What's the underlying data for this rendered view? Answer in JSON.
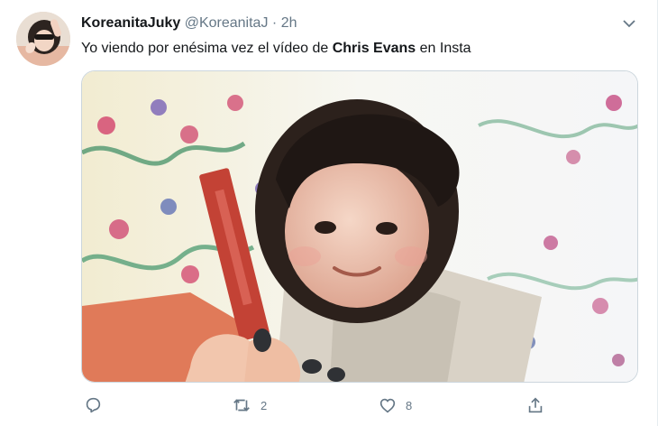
{
  "tweet": {
    "display_name": "KoreanitaJuky",
    "handle": "@KoreanitaJ",
    "separator": "·",
    "timestamp": "2h",
    "text_before": "Yo viendo por enésima vez el vídeo de ",
    "text_bold": "Chris Evans",
    "text_after": " en Insta"
  },
  "actions": {
    "reply": {
      "icon": "reply-icon",
      "count": ""
    },
    "retweet": {
      "icon": "retweet-icon",
      "count": "2"
    },
    "like": {
      "icon": "heart-icon",
      "count": "8"
    },
    "share": {
      "icon": "share-icon",
      "count": ""
    }
  },
  "colors": {
    "text": "#14171a",
    "secondary": "#657786",
    "border": "#ccd6dd"
  }
}
